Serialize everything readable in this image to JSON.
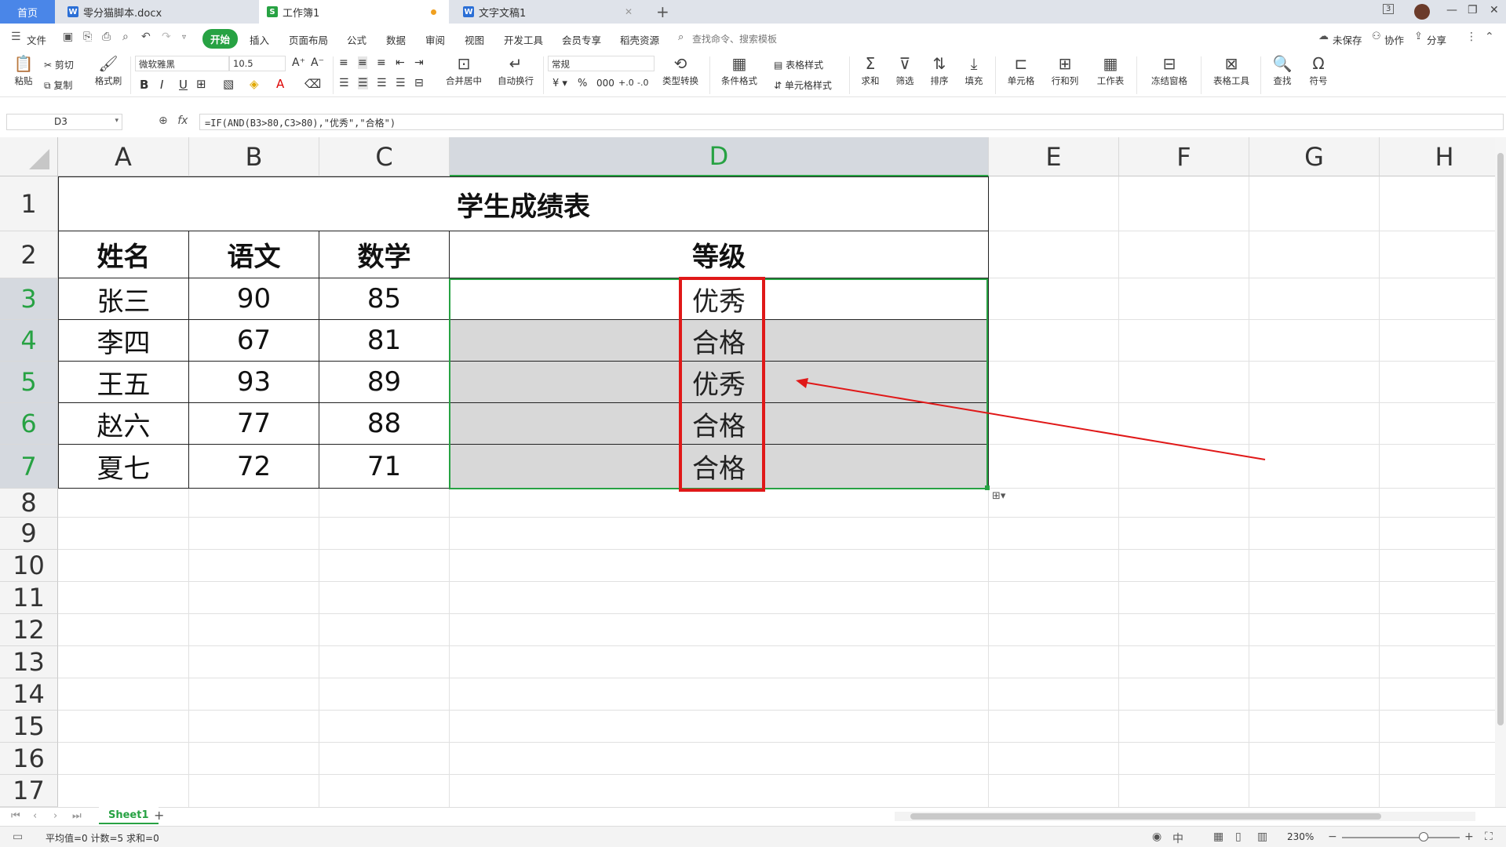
{
  "titlebar": {
    "home_tab": "首页",
    "doc_tab": "零分猫脚本.docx",
    "sheet_tab": "工作簿1",
    "text_tab": "文字文稿1",
    "new_tab": "+",
    "badge": "3"
  },
  "menubar": {
    "file": "文件",
    "items": [
      "开始",
      "插入",
      "页面布局",
      "公式",
      "数据",
      "审阅",
      "视图",
      "开发工具",
      "会员专享",
      "稻壳资源"
    ],
    "search_placeholder": "查找命令、搜索模板",
    "unsaved": "未保存",
    "collaborate": "协作",
    "share": "分享"
  },
  "ribbon": {
    "paste": "粘贴",
    "cut": "剪切",
    "copy": "复制",
    "format_painter": "格式刷",
    "font_name": "微软雅黑",
    "font_size": "10.5",
    "merge_center": "合并居中",
    "wrap_text": "自动换行",
    "number_format": "常规",
    "type_convert": "类型转换",
    "conditional_format": "条件格式",
    "table_style": "表格样式",
    "cell_style": "单元格样式",
    "sum": "求和",
    "filter": "筛选",
    "sort": "排序",
    "fill": "填充",
    "cell": "单元格",
    "row_col": "行和列",
    "worksheet": "工作表",
    "freeze": "冻结窗格",
    "table_tools": "表格工具",
    "find": "查找",
    "symbol": "符号"
  },
  "formulabar": {
    "name_box": "D3",
    "fx": "fx",
    "formula": "=IF(AND(B3>80,C3>80),\"优秀\",\"合格\")"
  },
  "grid": {
    "columns": [
      "A",
      "B",
      "C",
      "D",
      "E",
      "F",
      "G",
      "H"
    ],
    "rows": [
      "1",
      "2",
      "3",
      "4",
      "5",
      "6",
      "7",
      "8",
      "9",
      "10",
      "11",
      "12",
      "13",
      "14",
      "15",
      "16",
      "17"
    ],
    "selected_column": "D",
    "table_title": "学生成绩表",
    "headers": [
      "姓名",
      "语文",
      "数学",
      "等级"
    ],
    "records": [
      [
        "张三",
        "90",
        "85",
        "优秀"
      ],
      [
        "李四",
        "67",
        "81",
        "合格"
      ],
      [
        "王五",
        "93",
        "89",
        "优秀"
      ],
      [
        "赵六",
        "77",
        "88",
        "合格"
      ],
      [
        "夏七",
        "72",
        "71",
        "合格"
      ]
    ]
  },
  "sheets": {
    "active": "Sheet1",
    "add": "+"
  },
  "statusbar": {
    "summary": "平均值=0  计数=5  求和=0",
    "zoom": "230%"
  },
  "colors": {
    "accent": "#27a243",
    "highlight": "#e01818",
    "selection_fill": "#d8d8d8"
  }
}
